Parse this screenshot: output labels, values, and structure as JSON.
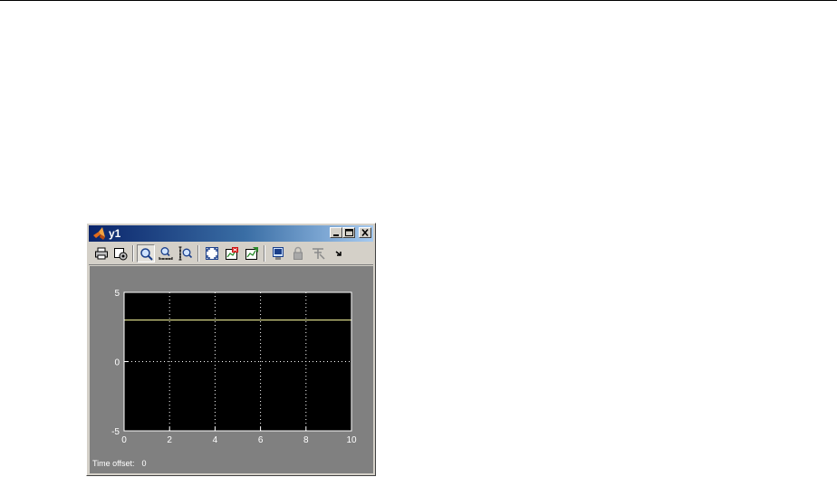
{
  "window": {
    "title": "y1"
  },
  "toolbar": {
    "buttons": [
      {
        "name": "print-icon"
      },
      {
        "name": "parameters-icon"
      },
      {
        "name": "zoom-icon"
      },
      {
        "name": "zoom-x-icon"
      },
      {
        "name": "zoom-y-icon"
      },
      {
        "name": "autoscale-icon"
      },
      {
        "name": "save-axes-settings-icon"
      },
      {
        "name": "restore-axes-settings-icon"
      },
      {
        "name": "floating-scope-icon"
      },
      {
        "name": "lock-axes-icon"
      },
      {
        "name": "signal-selection-icon"
      },
      {
        "name": "toolbar-overflow-icon"
      }
    ]
  },
  "scope": {
    "time_offset_label": "Time offset:",
    "time_offset_value": "0"
  },
  "colors": {
    "background": "#808080",
    "plot_background": "#000000",
    "grid": "#ffffff",
    "signal": "#ffffa0"
  },
  "chart_data": {
    "type": "line",
    "x_ticks": [
      "0",
      "2",
      "4",
      "6",
      "8",
      "10"
    ],
    "y_ticks": [
      "-5",
      "0",
      "5"
    ],
    "xlim": [
      0,
      10
    ],
    "ylim": [
      -5,
      5
    ],
    "grid": true,
    "series": [
      {
        "x": [
          0,
          10
        ],
        "y": [
          3,
          3
        ]
      }
    ]
  }
}
